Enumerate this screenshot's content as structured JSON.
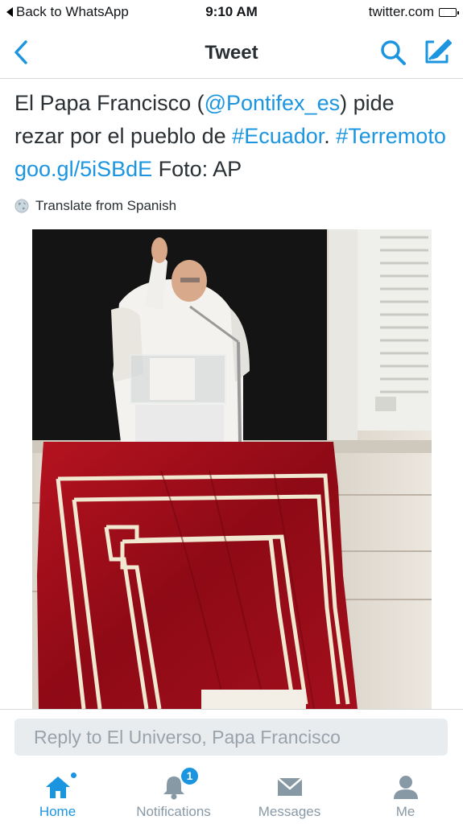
{
  "status_bar": {
    "back_app": "Back to WhatsApp",
    "time": "9:10 AM",
    "domain": "twitter.com",
    "battery_level": 0.9
  },
  "nav": {
    "title": "Tweet",
    "back_icon": "chevron-left-icon",
    "search_icon": "search-icon",
    "compose_icon": "compose-icon"
  },
  "tweet": {
    "text_1": "El Papa Francisco (",
    "mention": "@Pontifex_es",
    "text_2": ") pide rezar por el pueblo de ",
    "hashtag_1": "#Ecuador",
    "text_3": ". ",
    "hashtag_2": "#Terremoto",
    "text_4": " ",
    "link": "goo.gl/5iSBdE",
    "text_5": " Foto: AP",
    "translate_label": "Translate from Spanish"
  },
  "reply": {
    "placeholder": "Reply to El Universo, Papa Francisco"
  },
  "tabs": [
    {
      "label": "Home",
      "icon": "home-icon",
      "active": true
    },
    {
      "label": "Notifications",
      "icon": "bell-icon",
      "badge": "1"
    },
    {
      "label": "Messages",
      "icon": "envelope-icon"
    },
    {
      "label": "Me",
      "icon": "person-icon"
    }
  ],
  "colors": {
    "accent": "#1b95e0",
    "inactive_tab": "#8899a6",
    "tapestry_red": "#a00c1a",
    "reply_box": "#e8ecef"
  }
}
